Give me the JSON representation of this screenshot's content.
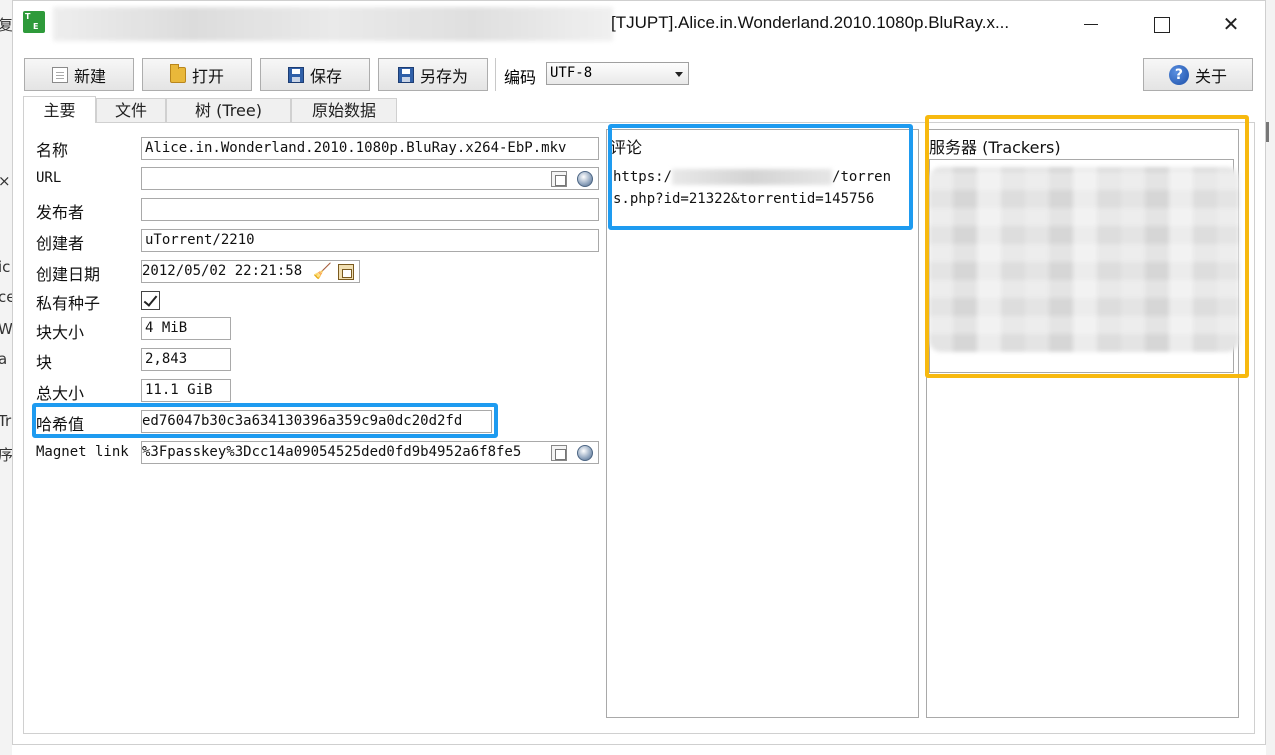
{
  "background_window": {
    "fragments": [
      "复",
      "×",
      "ic",
      "ce",
      "W",
      "a",
      "Tr",
      "序"
    ]
  },
  "window": {
    "title": "[TJUPT].Alice.in.Wonderland.2010.1080p.BluRay.x...",
    "app_icon_letters": [
      "T",
      "E"
    ]
  },
  "toolbar": {
    "new_label": "新建",
    "open_label": "打开",
    "save_label": "保存",
    "save_as_label": "另存为",
    "encoding_label": "编码",
    "encoding_value": "UTF-8",
    "about_label": "关于",
    "about_icon_glyph": "?"
  },
  "tabs": [
    {
      "label": "主要",
      "active": true
    },
    {
      "label": "文件",
      "active": false
    },
    {
      "label": "树 (Tree)",
      "active": false
    },
    {
      "label": "原始数据",
      "active": false
    }
  ],
  "main": {
    "name_label": "名称",
    "name_value": "Alice.in.Wonderland.2010.1080p.BluRay.x264-EbP.mkv",
    "url_label": "URL",
    "url_value": "",
    "publisher_label": "发布者",
    "publisher_value": "",
    "creator_label": "创建者",
    "creator_value": "uTorrent/2210",
    "date_label": "创建日期",
    "date_value": "2012/05/02 22:21:58",
    "private_label": "私有种子",
    "private_checked": true,
    "piece_size_label": "块大小",
    "piece_size_value": "4 MiB",
    "pieces_label": "块",
    "pieces_value": "2,843",
    "total_size_label": "总大小",
    "total_size_value": "11.1 GiB",
    "hash_label": "哈希值",
    "hash_value": "ed76047b30c3a634130396a359c9a0dc20d2fd",
    "magnet_label": "Magnet link",
    "magnet_value": "%3Fpasskey%3Dcc14a09054525ded0fd9b4952a6f8fe5"
  },
  "comment": {
    "title": "评论",
    "line1_start": "https:/",
    "line1_end": "/torren",
    "line2": "s.php?id=21322&torrentid=145756"
  },
  "trackers": {
    "title": "服务器 (Trackers)"
  },
  "colors": {
    "highlight_blue": "#1e9bf0",
    "highlight_yellow": "#f7b90f",
    "app_icon_green": "#2e9a3a"
  }
}
